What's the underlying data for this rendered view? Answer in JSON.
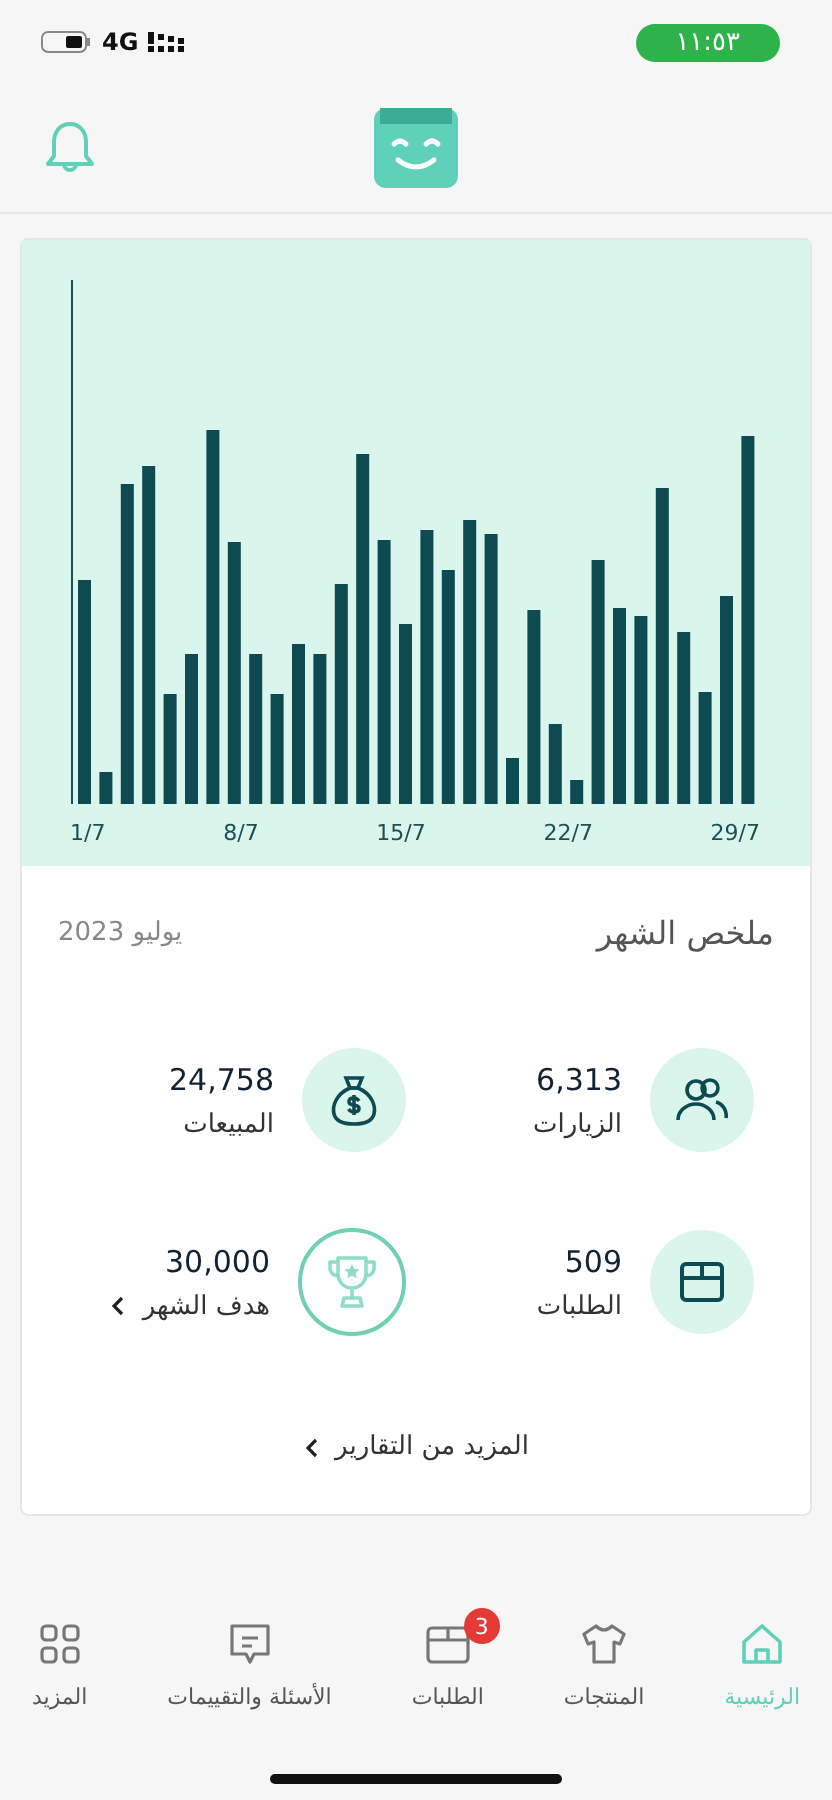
{
  "status_bar": {
    "network": "4G",
    "time": "١١:٥٣"
  },
  "chart_card": {
    "x_labels": [
      "29/7",
      "22/7",
      "15/7",
      "8/7",
      "1/7"
    ]
  },
  "summary": {
    "title": "ملخص الشهر",
    "period": "يوليو 2023",
    "stats": [
      {
        "kind": "visits",
        "value": "6,313",
        "label": "الزيارات"
      },
      {
        "kind": "sales",
        "value": "24,758",
        "label": "المبيعات"
      },
      {
        "kind": "orders",
        "value": "509",
        "label": "الطلبات"
      },
      {
        "kind": "goal",
        "value": "30,000",
        "label": "هدف الشهر"
      }
    ],
    "more_link": "المزيد من التقارير"
  },
  "tab_bar": [
    {
      "kind": "home",
      "label": "الرئيسية",
      "selected": true
    },
    {
      "kind": "products",
      "label": "المنتجات",
      "selected": false
    },
    {
      "kind": "orders",
      "label": "الطلبات",
      "selected": false,
      "badge": "3"
    },
    {
      "kind": "reviews",
      "label": "الأسئلة والتقييمات",
      "selected": false
    },
    {
      "kind": "more",
      "label": "المزيد",
      "selected": false
    }
  ]
}
